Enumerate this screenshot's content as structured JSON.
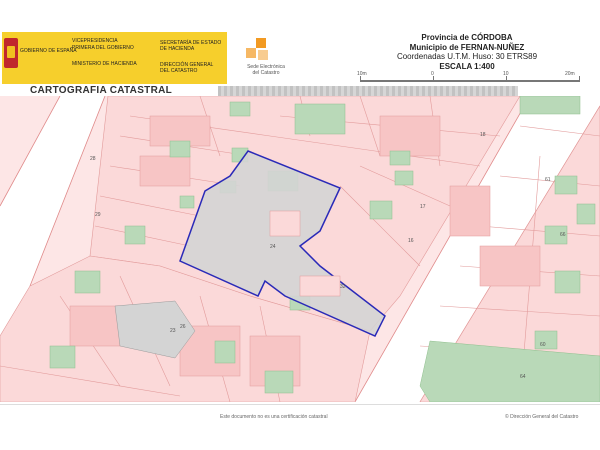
{
  "header": {
    "gov_brand": "GOBIERNO DE ESPAÑA",
    "vice_line1": "VICEPRESIDENCIA",
    "vice_line2": "PRIMERA DEL GOBIERNO",
    "ministry": "MINISTERIO DE HACIENDA",
    "secretaria_line1": "SECRETARÍA DE ESTADO",
    "secretaria_line2": "DE HACIENDA",
    "direccion_line1": "DIRECCIÓN GENERAL",
    "direccion_line2": "DEL CATASTRO",
    "sede_line1": "Sede Electrónica",
    "sede_line2": "del Catastro",
    "provincia": "Provincia de CÓRDOBA",
    "municipio": "Municipio de FERNAN-NUÑEZ",
    "coordenadas": "Coordenadas U.T.M. Huso: 30 ETRS89",
    "escala": "ESCALA 1:400"
  },
  "scale": {
    "labels": [
      "10m",
      "0",
      "10",
      "20m"
    ]
  },
  "title": "CARTOGRAFIA CATASTRAL",
  "parcel_labels": [
    "24",
    "28",
    "29",
    "26",
    "16",
    "61",
    "18",
    "17",
    "60",
    "64",
    "66",
    "23",
    "32"
  ],
  "footer": {
    "disclaimer": "Este documento no es una certificación catastral",
    "copyright": "© Dirección General del Catastro"
  },
  "colors": {
    "parcel_fill": "#fbd9d9",
    "building_fill": "#f7c5c5",
    "courtyard_fill": "#b9d9b8",
    "selected_fill": "#d4d4d4",
    "selected_outline": "#2a2ab8",
    "road_fill": "#ffffff",
    "gov_yellow": "#f6cf2c"
  }
}
